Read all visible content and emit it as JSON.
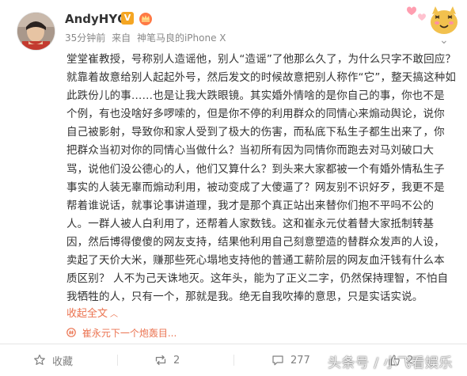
{
  "post": {
    "username": "AndyHYQ",
    "vip_badge": "V",
    "time": "35分钟前",
    "source_prefix": "来自",
    "source": "神笔马良的iPhone X"
  },
  "content_lines": [
    "堂堂崔教授，号称别人造谣他，别人“造谣”了他那么久了，为什么只字不敢回应？",
    "就靠着故意给别人起起外号，然后发文的时候故意把别人称作“它”，整天搞这种如",
    "此跌份儿的事……也是让我大跌眼镜。其实婚外情啥的是你自己的事，你也不是",
    "个例，有也没啥好多啰嗦的，但是你不停的利用群众的同情心来煽动舆论，说你",
    "自己被影射，导致你和家人受到了极大的伤害，而私底下私生子都生出来了，你",
    "把群众当初对你的同情心当做什么？当初所有因为同情你而跑去对马刘破口大",
    "骂，说他们没公德心的人，他们又算什么？到头来大家都被一个有婚外情私生子",
    "事实的人装无辜而煽动利用，被动变成了大傻逼了？网友别不识好歹，我更不是",
    "帮着谁说话，就事论事讲道理，我才是那个真正站出来替你们抱不平吗不公的",
    "人。一群人被人白利用了，还帮着人家数钱。这和崔永元仗着替大家抵制转基",
    "因，然后博得傻傻的网友支持，结果他利用自己刻意塑造的替群众发声的人设，",
    "卖起了天价大米，赚那些死心塌地支持他的普通工薪阶层的网友血汗钱有什么本",
    "质区别？ 人不为己天诛地灭。这年头，能为了正义二字，仍然保持理智，不怕自",
    "我牺牲的人，只有一个，那就是我。绝无自我吹捧的意思，只是实话实说。"
  ],
  "collapse_label": "收起全文",
  "topic_label": "崔永元下一个炮轰目...",
  "actions": {
    "favorite_label": "收藏",
    "repost_count": "2",
    "comment_count": "277",
    "like_count": "2"
  },
  "watermark": "头条号 / 小飞看娱乐",
  "colors": {
    "link": "#eb7350",
    "text": "#333333",
    "meta": "#888888",
    "vip": "#f5a623"
  },
  "icons": [
    "vip-v-icon",
    "crown-badge-icon",
    "sticker-icon",
    "topic-icon",
    "star-icon",
    "repost-icon",
    "comment-icon",
    "like-icon"
  ]
}
